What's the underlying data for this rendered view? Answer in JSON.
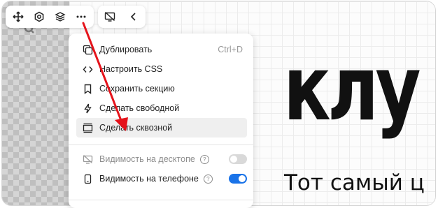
{
  "canvas": {
    "headline": "клу",
    "subheadline": "Тот самый ц"
  },
  "toolbar": {
    "buttons": [
      {
        "icon": "move-icon"
      },
      {
        "icon": "settings-hexagon-icon"
      },
      {
        "icon": "layers-icon"
      },
      {
        "icon": "more-icon"
      }
    ],
    "secondary": [
      {
        "icon": "monitor-off-icon"
      },
      {
        "icon": "chevron-left-icon"
      }
    ]
  },
  "menu": {
    "items": [
      {
        "label": "Дублировать",
        "shortcut": "Ctrl+D",
        "icon": "duplicate-icon"
      },
      {
        "label": "Настроить CSS",
        "icon": "code-icon"
      },
      {
        "label": "Сохранить секцию",
        "icon": "bookmark-icon"
      },
      {
        "label": "Сделать свободной",
        "icon": "lightning-icon"
      },
      {
        "label": "Сделать сквозной",
        "icon": "through-section-icon",
        "highlighted": true
      }
    ],
    "visibility": [
      {
        "label": "Видимость на десктопе",
        "enabled": false,
        "icon": "desktop-off-icon"
      },
      {
        "label": "Видимость на телефоне",
        "enabled": true,
        "icon": "phone-icon"
      }
    ]
  },
  "colors": {
    "toggle_on": "#1a73e8",
    "toggle_off": "#d9d9d9",
    "annotation_arrow": "#e5131b",
    "highlight": "#efefef"
  }
}
